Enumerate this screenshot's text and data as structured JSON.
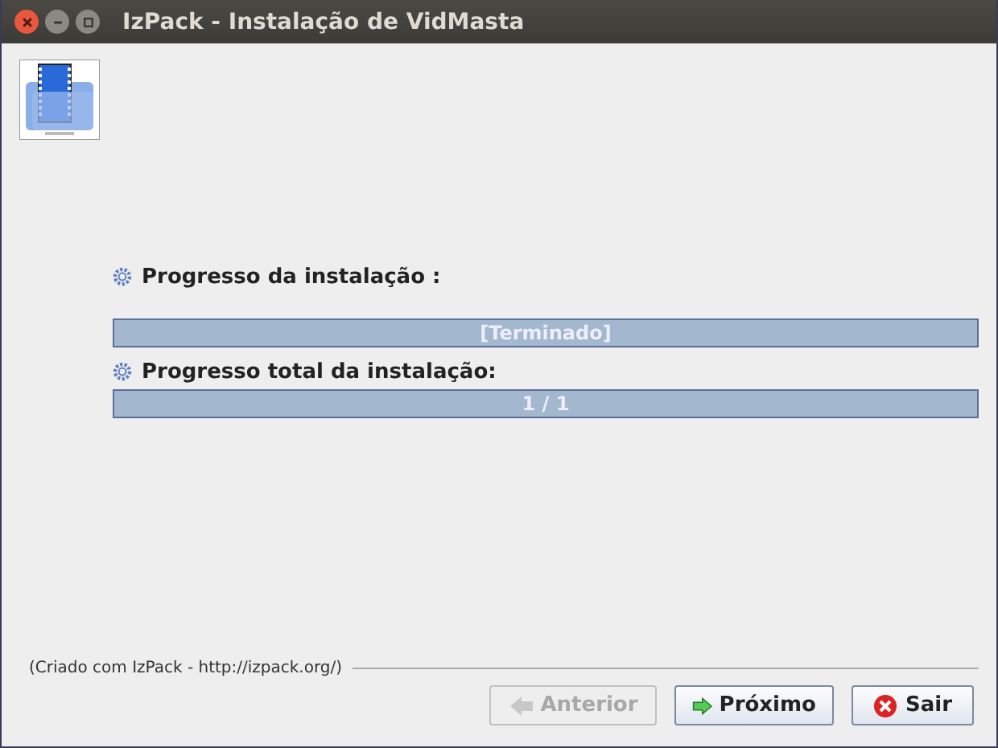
{
  "window": {
    "title": "IzPack - Instalação de VidMasta"
  },
  "progress": [
    {
      "label": "Progresso da instalação :",
      "level": 1,
      "text": "[Terminado]"
    },
    {
      "label": "Progresso total da instalação:",
      "level": 1,
      "text": "1 / 1"
    }
  ],
  "footer": "(Criado com IzPack - http://izpack.org/)",
  "buttons": [
    {
      "label": "Anterior",
      "kind": "back",
      "disabled": true
    },
    {
      "label": "Próximo",
      "kind": "next",
      "disabled": false
    },
    {
      "label": "Sair",
      "kind": "quit",
      "disabled": false
    }
  ]
}
